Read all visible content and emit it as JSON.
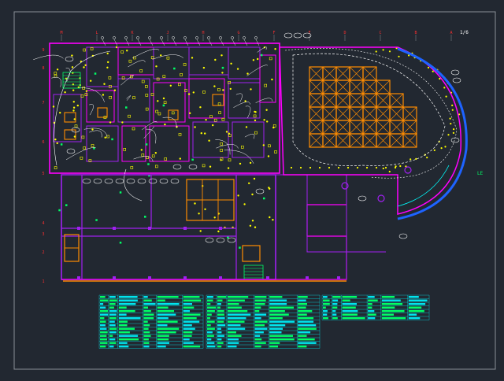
{
  "drawing": {
    "title_mark": "1/6",
    "grid_cols": [
      "M",
      "L",
      "K",
      "J",
      "H",
      "G",
      "F",
      "E",
      "D",
      "C",
      "B",
      "A"
    ],
    "grid_rows": [
      "9",
      "8",
      "7",
      "6",
      "5",
      "4",
      "3",
      "2",
      "1"
    ],
    "right_label": "LE"
  },
  "colors": {
    "background": "#222831",
    "frame": "#8a8f96",
    "wall": "#ff00ff",
    "wall_dark": "#a020f0",
    "fixture": "#ffff00",
    "cable": "#ffffff",
    "grid_tag": "#ff3030",
    "orange_grid": "#ff8c00",
    "table_green": "#00ff66",
    "table_cyan": "#00e5ee",
    "blue_curve": "#1e63ff"
  },
  "legend_tables": [
    {
      "rows": 15
    },
    {
      "rows": 15
    },
    {
      "rows": 7
    }
  ]
}
